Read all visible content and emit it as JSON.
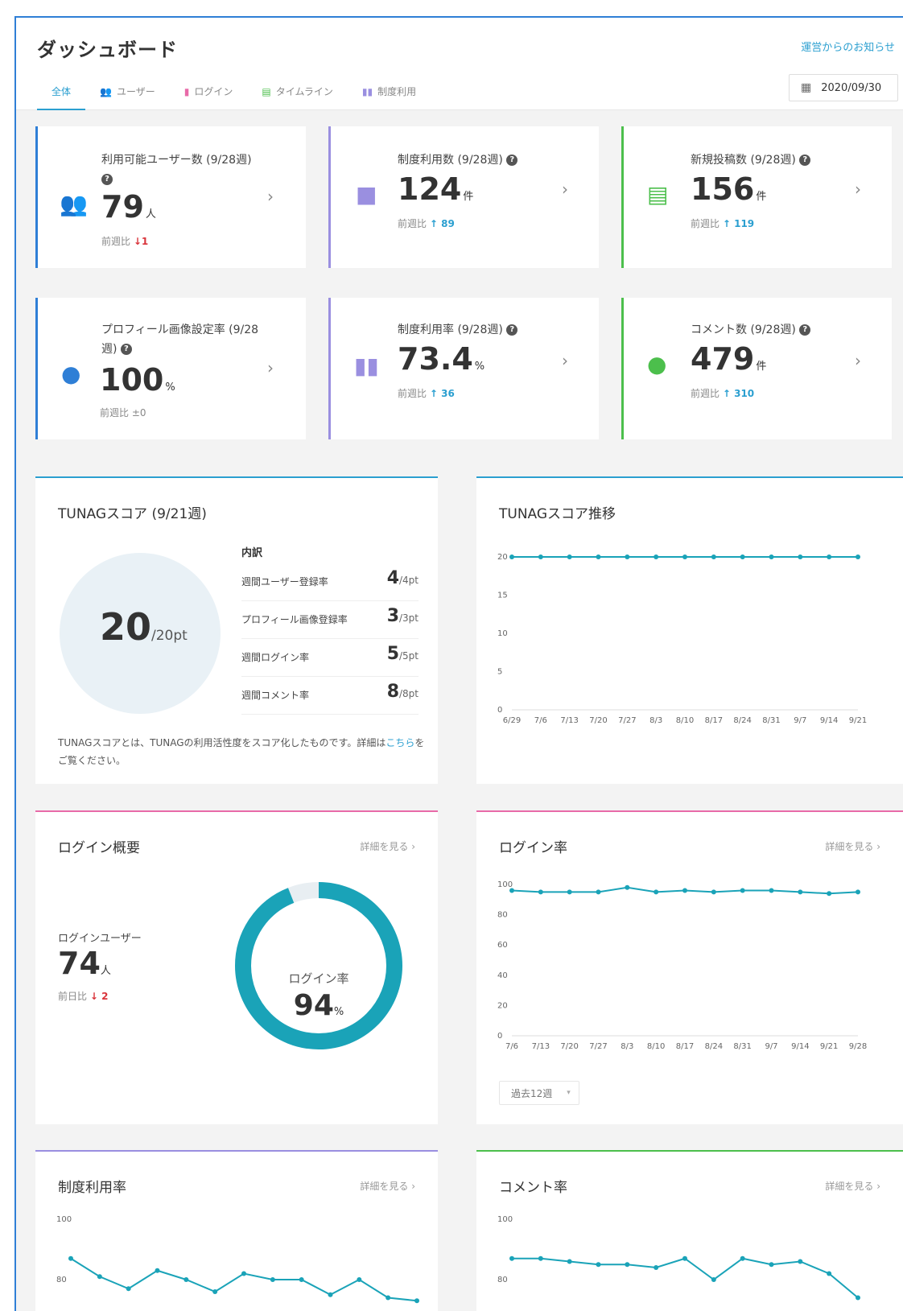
{
  "header": {
    "title": "ダッシュボード",
    "notice_link": "運営からのお知らせ",
    "date": "2020/09/30",
    "tabs": [
      {
        "label": "全体",
        "icon": ""
      },
      {
        "label": "ユーザー",
        "icon": "users-icon"
      },
      {
        "label": "ログイン",
        "icon": "login-icon"
      },
      {
        "label": "タイムライン",
        "icon": "timeline-icon"
      },
      {
        "label": "制度利用",
        "icon": "book-icon"
      }
    ]
  },
  "stats": [
    {
      "label": "利用可能ユーザー数 (9/28週)",
      "value": "79",
      "unit": "人",
      "diff_label": "前週比",
      "diff_arrow": "↓",
      "diff_value": "1",
      "diff_dir": "down",
      "icon": "users-icon",
      "color": "#2f7fd6"
    },
    {
      "label": "制度利用数 (9/28週)",
      "value": "124",
      "unit": "件",
      "diff_label": "前週比",
      "diff_arrow": "↑",
      "diff_value": "89",
      "diff_dir": "up",
      "icon": "gift-icon",
      "color": "#9a8fe0"
    },
    {
      "label": "新規投稿数 (9/28週)",
      "value": "156",
      "unit": "件",
      "diff_label": "前週比",
      "diff_arrow": "↑",
      "diff_value": "119",
      "diff_dir": "up",
      "icon": "list-icon",
      "color": "#4cbf4c"
    },
    {
      "label": "プロフィール画像設定率 (9/28週)",
      "value": "100",
      "unit": "%",
      "diff_label": "前週比",
      "diff_arrow": "",
      "diff_value": "±0",
      "diff_dir": "flat",
      "icon": "profile-icon",
      "color": "#2f7fd6"
    },
    {
      "label": "制度利用率 (9/28週)",
      "value": "73.4",
      "unit": "%",
      "diff_label": "前週比",
      "diff_arrow": "↑",
      "diff_value": "36",
      "diff_dir": "up",
      "icon": "book-icon",
      "color": "#9a8fe0"
    },
    {
      "label": "コメント数 (9/28週)",
      "value": "479",
      "unit": "件",
      "diff_label": "前週比",
      "diff_arrow": "↑",
      "diff_value": "310",
      "diff_dir": "up",
      "icon": "comment-icon",
      "color": "#4cbf4c"
    }
  ],
  "score": {
    "title": "TUNAGスコア (9/21週)",
    "value": "20",
    "unit": "/20pt",
    "breakdown_title": "内訳",
    "breakdown": [
      {
        "label": "週間ユーザー登録率",
        "value": "4",
        "unit": "/4pt"
      },
      {
        "label": "プロフィール画像登録率",
        "value": "3",
        "unit": "/3pt"
      },
      {
        "label": "週間ログイン率",
        "value": "5",
        "unit": "/5pt"
      },
      {
        "label": "週間コメント率",
        "value": "8",
        "unit": "/8pt"
      }
    ],
    "note": "TUNAGスコアとは、TUNAGの利用活性度をスコア化したものです。詳細は",
    "note_link": "こちら",
    "note_end": "をご覧ください。"
  },
  "score_trend": {
    "title": "TUNAGスコア推移"
  },
  "login_summary": {
    "title": "ログイン概要",
    "detail": "詳細を見る ›",
    "user_label": "ログインユーザー",
    "user_value": "74",
    "user_unit": "人",
    "diff_label": "前日比",
    "diff_arrow": "↓",
    "diff_value": "2",
    "rate_label": "ログイン率",
    "rate_value": "94",
    "rate_unit": "%",
    "rate": 94
  },
  "login_rate": {
    "title": "ログイン率",
    "detail": "詳細を見る ›",
    "period": "過去12週",
    "period_caret": "▾"
  },
  "usage_rate": {
    "title": "制度利用率",
    "detail": "詳細を見る ›"
  },
  "comment_rate": {
    "title": "コメント率",
    "detail": "詳細を見る ›"
  },
  "colors": {
    "accent": "#2b9fd0",
    "line": "#1aa3b8",
    "down": "#d9343b",
    "blue": "#2f7fd6",
    "purple": "#9a8fe0",
    "green": "#4cbf4c",
    "pink": "#e86aa8"
  },
  "chart_data": [
    {
      "type": "line",
      "x": [
        "6/29",
        "7/6",
        "7/13",
        "7/20",
        "7/27",
        "8/3",
        "8/10",
        "8/17",
        "8/24",
        "8/31",
        "9/7",
        "9/14",
        "9/21"
      ],
      "series": [
        {
          "values": [
            20,
            20,
            20,
            20,
            20,
            20,
            20,
            20,
            20,
            20,
            20,
            20,
            20
          ]
        }
      ],
      "yticks": [
        0,
        5,
        10,
        15,
        20
      ],
      "ylim": [
        0,
        20
      ]
    },
    {
      "type": "line",
      "x": [
        "7/6",
        "7/13",
        "7/20",
        "7/27",
        "8/3",
        "8/10",
        "8/17",
        "8/24",
        "8/31",
        "9/7",
        "9/14",
        "9/21",
        "9/28"
      ],
      "series": [
        {
          "values": [
            96,
            95,
            95,
            95,
            98,
            95,
            96,
            95,
            96,
            96,
            95,
            94,
            95
          ]
        }
      ],
      "yticks": [
        0,
        20,
        40,
        60,
        80,
        100
      ],
      "ylim": [
        0,
        100
      ]
    },
    {
      "type": "line",
      "x": [
        "",
        "",
        "",
        "",
        "",
        "",
        "",
        "",
        "",
        "",
        "",
        "",
        ""
      ],
      "series": [
        {
          "values": [
            87,
            81,
            77,
            83,
            80,
            76,
            82,
            80,
            80,
            75,
            80,
            74,
            73
          ]
        }
      ],
      "yticks": [
        60,
        80,
        100
      ],
      "ylim": [
        60,
        100
      ]
    },
    {
      "type": "line",
      "x": [
        "",
        "",
        "",
        "",
        "",
        "",
        "",
        "",
        "",
        "",
        "",
        "",
        ""
      ],
      "series": [
        {
          "values": [
            87,
            87,
            86,
            85,
            85,
            84,
            87,
            80,
            87,
            85,
            86,
            82,
            74
          ]
        }
      ],
      "yticks": [
        60,
        80,
        100
      ],
      "ylim": [
        60,
        100
      ]
    }
  ]
}
